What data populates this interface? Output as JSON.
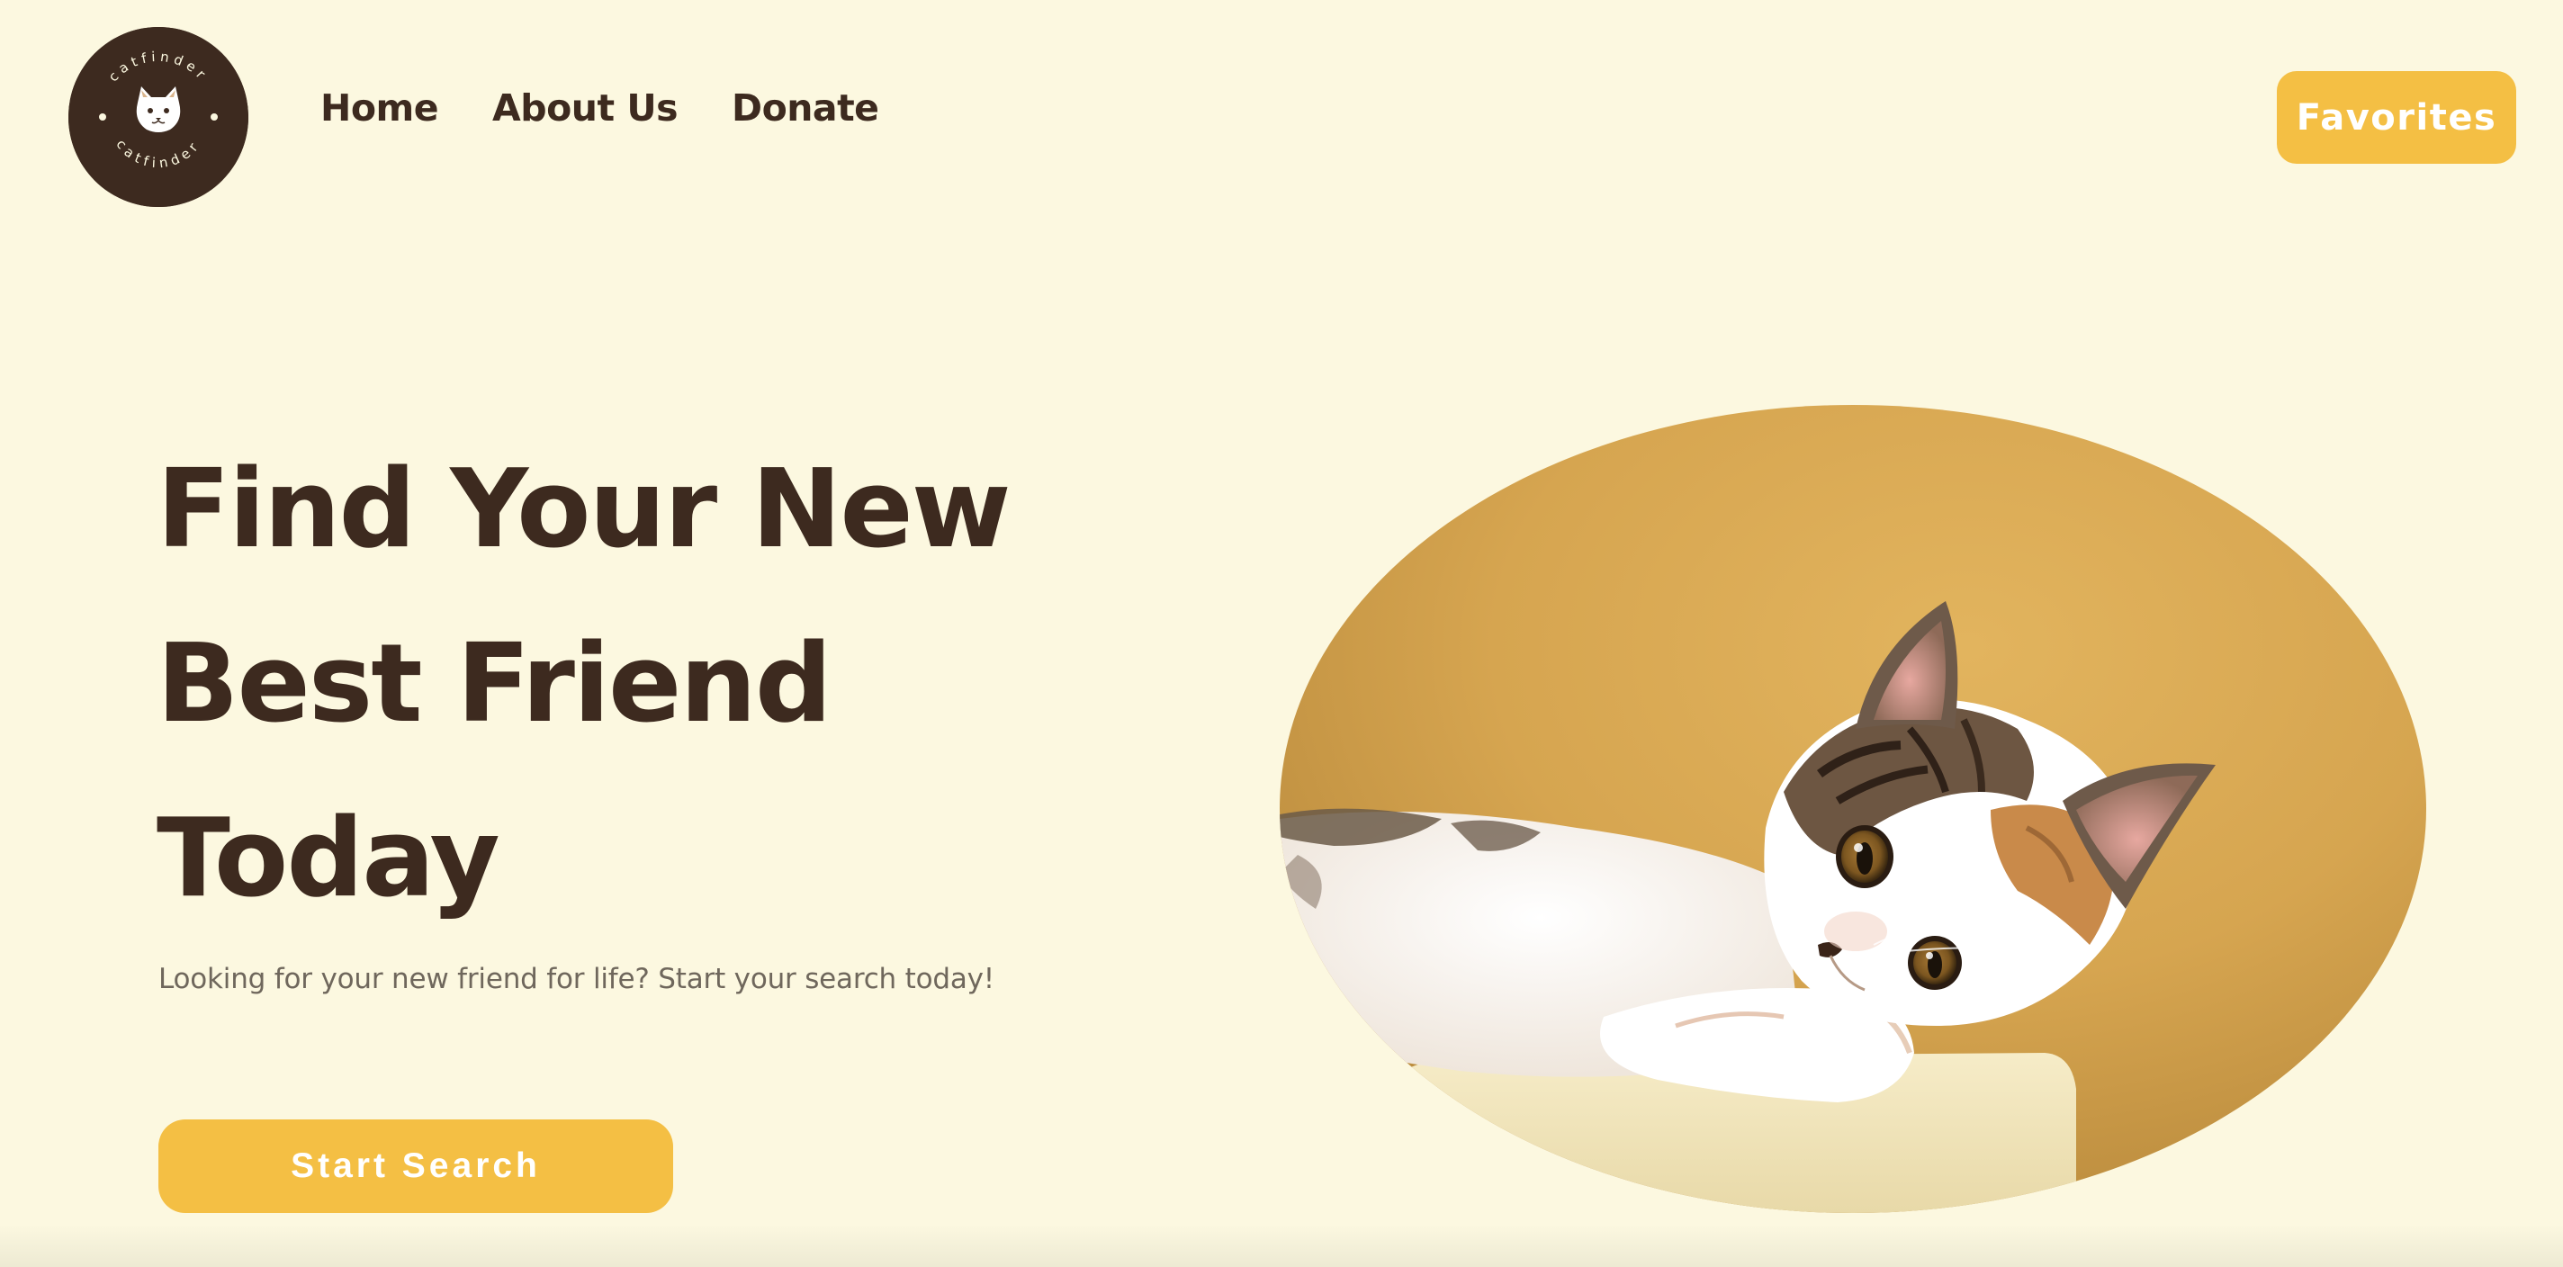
{
  "brand": {
    "logo_text": "catfinder",
    "logo_icon": "cat-face-icon"
  },
  "nav": {
    "items": [
      {
        "label": "Home"
      },
      {
        "label": "About Us"
      },
      {
        "label": "Donate"
      }
    ]
  },
  "header": {
    "favorites_label": "Favorites"
  },
  "hero": {
    "title_lines": [
      "Find Your New",
      "Best Friend",
      "Today"
    ],
    "subtitle": "Looking for your new friend for life? Start your search today!",
    "cta_label": "Start Search",
    "image": "kitten-photo"
  },
  "colors": {
    "background": "#fcf8e0",
    "text_dark": "#3d2a1f",
    "accent": "#f4bf44",
    "subtitle": "#6f675c"
  }
}
